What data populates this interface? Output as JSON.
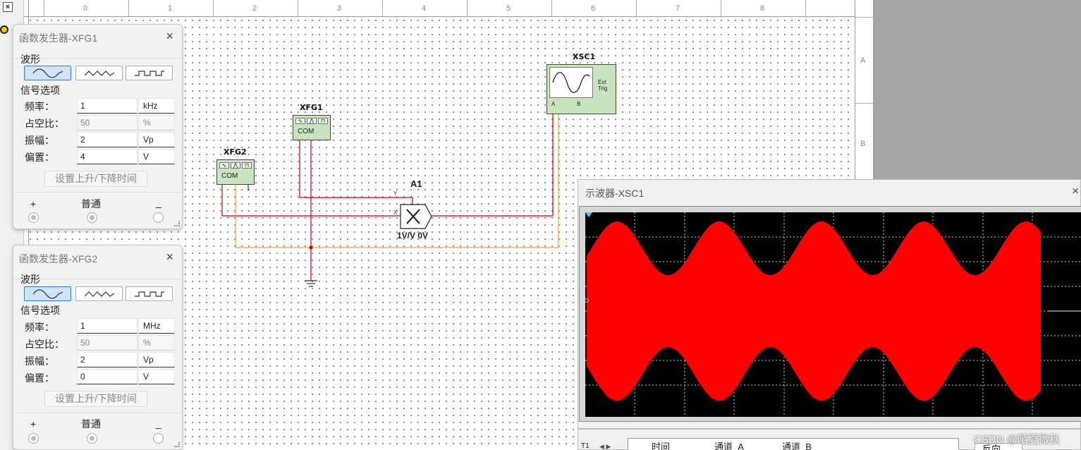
{
  "workspace": {
    "close_glyph": "×",
    "ruler_numbers": [
      "0",
      "1",
      "2",
      "3",
      "4",
      "5",
      "6",
      "7",
      "8"
    ],
    "row_letters": [
      "A",
      "B"
    ]
  },
  "schematic": {
    "xfg1_label": "XFG1",
    "xfg2_label": "XFG2",
    "xsc1_label": "XSC1",
    "com_label": "COM",
    "ext_trig_label": "Ext Trig",
    "channel_a_pin": "A",
    "channel_b_pin": "B",
    "multiplier_label": "A1",
    "multiplier_value": "1V/V 0V",
    "pin_y": "Y",
    "pin_x": "X",
    "wire_colors": {
      "red": "#d40000",
      "orange": "#f0a030"
    }
  },
  "fg1": {
    "title": "函数发生器-XFG1",
    "close": "×",
    "waveform_label": "波形",
    "signal_options_label": "信号选项",
    "selected_waveform": "sine",
    "params": [
      {
        "label": "频率：",
        "value": "1",
        "unit": "kHz",
        "disabled": false
      },
      {
        "label": "占空比：",
        "value": "50",
        "unit": "%",
        "disabled": true
      },
      {
        "label": "振幅：",
        "value": "2",
        "unit": "Vp",
        "disabled": false
      },
      {
        "label": "偏置：",
        "value": "4",
        "unit": "V",
        "disabled": false
      }
    ],
    "rise_fall_button": "设置上升/下降时间",
    "terminal_plus": "+",
    "terminal_common": "普通",
    "terminal_minus": "_"
  },
  "fg2": {
    "title": "函数发生器-XFG2",
    "close": "×",
    "waveform_label": "波形",
    "signal_options_label": "信号选项",
    "selected_waveform": "sine",
    "params": [
      {
        "label": "频率：",
        "value": "1",
        "unit": "MHz",
        "disabled": false
      },
      {
        "label": "占空比：",
        "value": "50",
        "unit": "%",
        "disabled": true
      },
      {
        "label": "振幅：",
        "value": "2",
        "unit": "Vp",
        "disabled": false
      },
      {
        "label": "偏置：",
        "value": "0",
        "unit": "V",
        "disabled": false
      }
    ],
    "rise_fall_button": "设置上升/下降时间",
    "terminal_plus": "+",
    "terminal_common": "普通",
    "terminal_minus": "_"
  },
  "oscilloscope": {
    "title": "示波器-XSC1",
    "close": "×",
    "trace_color": "#ff0000",
    "header_time": "时间",
    "header_channel_a": "通道_A",
    "header_channel_b": "通道_B",
    "t1_label": "T1",
    "reverse_button": "反向"
  },
  "watermark": "CSDN @陌夏微秋"
}
